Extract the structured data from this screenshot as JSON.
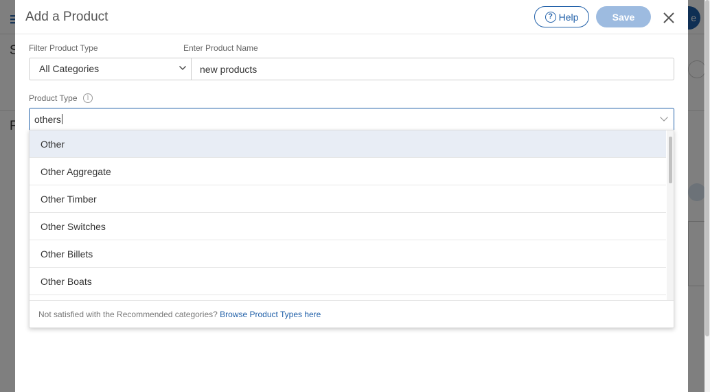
{
  "background": {
    "hamburger_glyph": "☰",
    "letter_s": "S",
    "letter_f": "F",
    "right_button_fragment": "e"
  },
  "modal": {
    "title": "Add a Product",
    "help_label": "Help",
    "save_label": "Save"
  },
  "form": {
    "filter_label": "Filter Product Type",
    "filter_value": "All Categories",
    "name_label": "Enter Product Name",
    "name_value": "new products",
    "type_label": "Product Type",
    "type_value": "others"
  },
  "dropdown": {
    "items": [
      {
        "label": "Other",
        "active": true
      },
      {
        "label": "Other Aggregate",
        "active": false
      },
      {
        "label": "Other Timber",
        "active": false
      },
      {
        "label": "Other Switches",
        "active": false
      },
      {
        "label": "Other Billets",
        "active": false
      },
      {
        "label": "Other Boats",
        "active": false
      }
    ],
    "footer_text": "Not satisfied with the Recommended categories?",
    "footer_link": "Browse Product Types here"
  },
  "colors": {
    "accent": "#1f5fa8",
    "save_disabled": "#9dbbe0",
    "active_row": "#e8edf5"
  }
}
